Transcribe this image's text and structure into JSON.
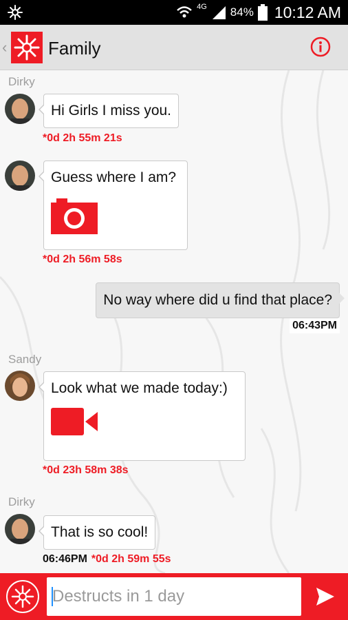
{
  "status_bar": {
    "network": "4G",
    "battery": "84%",
    "time": "10:12 AM"
  },
  "header": {
    "title": "Family",
    "back_glyph": "‹",
    "info_icon": "info-circle-icon"
  },
  "messages": [
    {
      "sender": "Dirky",
      "text": "Hi Girls I miss you.",
      "timer": "*0d 2h 55m 21s"
    },
    {
      "text": "Guess where I am?",
      "media": "camera-icon",
      "timer": "*0d 2h 56m 58s"
    },
    {
      "outgoing": true,
      "text": "No way where did u find that place?",
      "time": "06:43PM"
    },
    {
      "sender": "Sandy",
      "text": "Look what we made today:)",
      "media": "video-camera-icon",
      "timer": "*0d 23h 58m 38s"
    },
    {
      "sender": "Dirky",
      "text": "That is so cool!",
      "time": "06:46PM",
      "timer": "*0d 2h 59m 55s"
    }
  ],
  "composer": {
    "placeholder": "Destructs in 1 day",
    "send_icon": "send-icon"
  },
  "colors": {
    "brand_red": "#ee1c25",
    "header_bg": "#e2e2e2",
    "status_bg": "#000000"
  }
}
